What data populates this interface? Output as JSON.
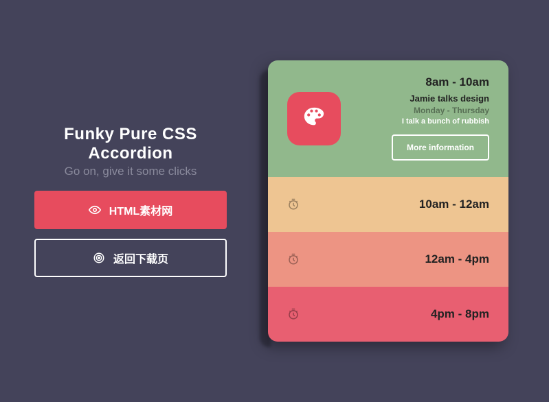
{
  "header": {
    "title": "Funky Pure CSS Accordion",
    "subtitle": "Go on, give it some clicks"
  },
  "buttons": {
    "primary": "HTML素材网",
    "outline": "返回下载页"
  },
  "accordion": {
    "items": [
      {
        "time": "8am - 10am",
        "title": "Jamie talks design",
        "days": "Monday - Thursday",
        "desc": "I talk a bunch of rubbish",
        "more": "More information",
        "expanded": true
      },
      {
        "time": "10am - 12am",
        "expanded": false
      },
      {
        "time": "12am - 4pm",
        "expanded": false
      },
      {
        "time": "4pm - 8pm",
        "expanded": false
      }
    ]
  }
}
